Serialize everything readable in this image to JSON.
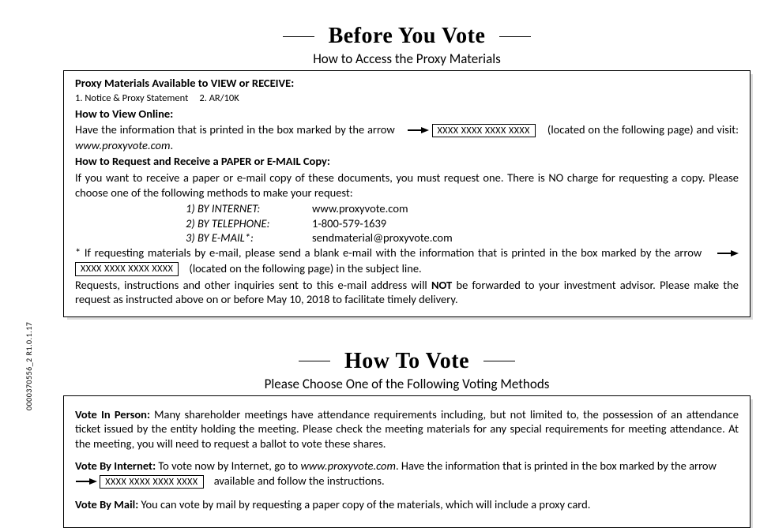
{
  "sidecode": "0000370556_2    R1.0.1.17",
  "section1": {
    "title": "Before You Vote",
    "subtitle": "How to Access the Proxy Materials",
    "availHead": "Proxy Materials Available to VIEW or RECEIVE:",
    "availItems": "1. Notice & Proxy Statement     2. AR/10K",
    "viewHead": "How to View Online:",
    "viewPre": "Have the information that is printed in the box marked by the arrow",
    "viewPost1": "(located on the following page) and visit:",
    "viewSite": "www.proxyvote.com",
    "reqHead": "How to Request and Receive a PAPER or E-MAIL Copy:",
    "reqBody": "If you want to receive a paper or e-mail copy of these documents, you must request one.  There is NO charge for requesting a copy.  Please choose one of the following methods to make your request:",
    "m1l": "1) BY INTERNET:",
    "m1r": "www.proxyvote.com",
    "m2l": "2) BY TELEPHONE:",
    "m2r": "1-800-579-1639",
    "m3l": "3) BY E-MAIL*:",
    "m3r": "sendmaterial@proxyvote.com",
    "notePre": "*   If requesting materials by e-mail, please send a blank e-mail with the information that is printed in the box marked by the arrow",
    "notePost": "(located on the following page) in the subject line.",
    "fwdPre": "Requests, instructions and other inquiries sent to this e-mail address will",
    "fwdBold": "NOT",
    "fwdPost": "be forwarded to your investment advisor. Please make the request as instructed above on or before May 10, 2018 to facilitate timely delivery."
  },
  "section2": {
    "title": "How To Vote",
    "subtitle": "Please Choose One of the Following Voting Methods",
    "p1b": "Vote In Person:",
    "p1": "Many shareholder meetings have attendance requirements including, but not limited to, the possession of an attendance ticket issued by the entity holding the meeting. Please check the meeting materials for any special requirements for meeting attendance.  At the meeting, you will need to request a ballot to vote these shares.",
    "p2b": "Vote By Internet:",
    "p2pre": "To vote now by Internet, go to",
    "p2site": "www.proxyvote.com",
    "p2mid": ".  Have the information that is printed in the box marked by the arrow",
    "p2post": "available and follow the instructions.",
    "p3b": "Vote By Mail:",
    "p3": "You can vote by mail by requesting a paper copy of the materials, which will include a proxy card."
  },
  "xplaceholder": "XXXX XXXX XXXX XXXX"
}
